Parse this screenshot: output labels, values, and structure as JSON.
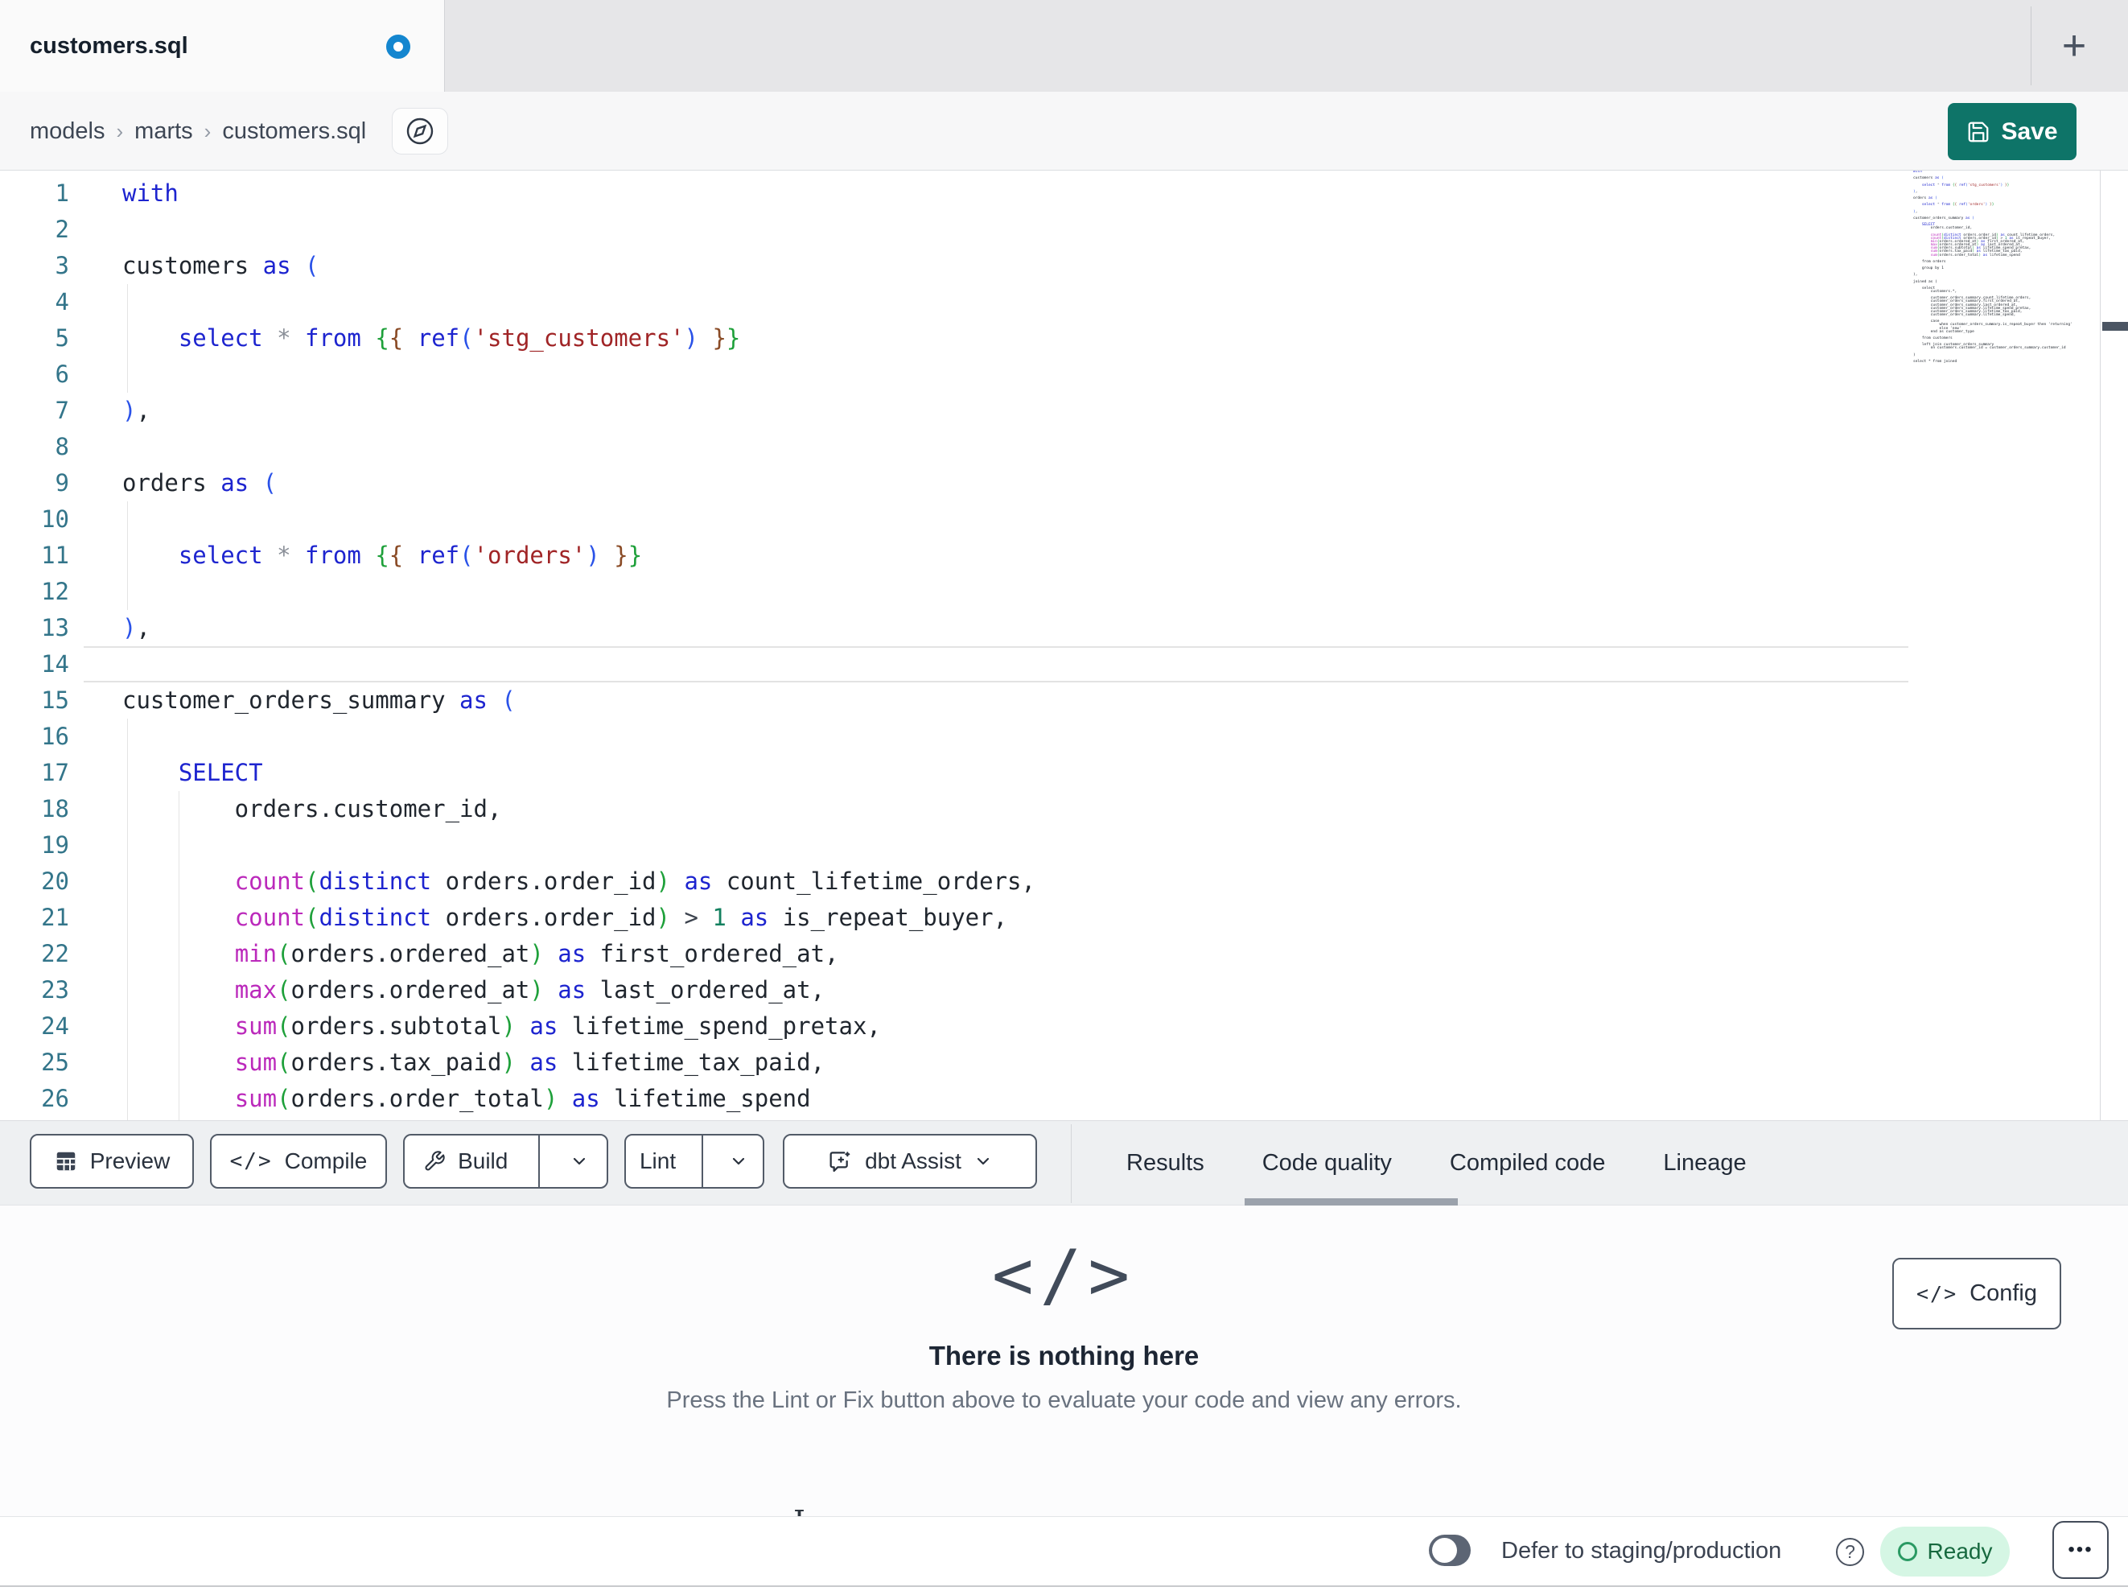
{
  "tab_bar": {
    "active_tab": "customers.sql",
    "new_tab_button": "+"
  },
  "breadcrumb": {
    "items": [
      "models",
      "marts",
      "customers.sql"
    ],
    "separator": "›"
  },
  "header": {
    "save_label": "Save"
  },
  "editor": {
    "active_line": 14,
    "line_count_visible": 26,
    "lines": [
      [
        [
          "with",
          "k"
        ]
      ],
      [],
      [
        [
          "customers ",
          "t"
        ],
        [
          "as",
          "k"
        ],
        [
          " ",
          "t"
        ],
        [
          "(",
          "p1"
        ]
      ],
      [],
      [
        [
          "    ",
          "t"
        ],
        [
          "select",
          "k"
        ],
        [
          " ",
          "t"
        ],
        [
          "*",
          "o"
        ],
        [
          " ",
          "t"
        ],
        [
          "from",
          "k"
        ],
        [
          " ",
          "t"
        ],
        [
          "{",
          "p2"
        ],
        [
          "{",
          "p3"
        ],
        [
          " ",
          "t"
        ],
        [
          "ref",
          "k"
        ],
        [
          "(",
          "p1"
        ],
        [
          "'stg_customers'",
          "s"
        ],
        [
          ")",
          "p1"
        ],
        [
          " ",
          "t"
        ],
        [
          "}",
          "p3"
        ],
        [
          "}",
          "p2"
        ]
      ],
      [],
      [
        [
          ")",
          "p1"
        ],
        [
          ",",
          "t"
        ]
      ],
      [],
      [
        [
          "orders ",
          "t"
        ],
        [
          "as",
          "k"
        ],
        [
          " ",
          "t"
        ],
        [
          "(",
          "p1"
        ]
      ],
      [],
      [
        [
          "    ",
          "t"
        ],
        [
          "select",
          "k"
        ],
        [
          " ",
          "t"
        ],
        [
          "*",
          "o"
        ],
        [
          " ",
          "t"
        ],
        [
          "from",
          "k"
        ],
        [
          " ",
          "t"
        ],
        [
          "{",
          "p2"
        ],
        [
          "{",
          "p3"
        ],
        [
          " ",
          "t"
        ],
        [
          "ref",
          "k"
        ],
        [
          "(",
          "p1"
        ],
        [
          "'orders'",
          "s"
        ],
        [
          ")",
          "p1"
        ],
        [
          " ",
          "t"
        ],
        [
          "}",
          "p3"
        ],
        [
          "}",
          "p2"
        ]
      ],
      [],
      [
        [
          ")",
          "p1"
        ],
        [
          ",",
          "t"
        ]
      ],
      [],
      [
        [
          "customer_orders_summary ",
          "t"
        ],
        [
          "as",
          "k"
        ],
        [
          " ",
          "t"
        ],
        [
          "(",
          "p1"
        ]
      ],
      [],
      [
        [
          "    ",
          "t"
        ],
        [
          "SELECT",
          "k"
        ]
      ],
      [
        [
          "        orders.customer_id,",
          "t"
        ]
      ],
      [],
      [
        [
          "        ",
          "t"
        ],
        [
          "count",
          "f"
        ],
        [
          "(",
          "p2"
        ],
        [
          "distinct",
          "k"
        ],
        [
          " orders.order_id",
          "t"
        ],
        [
          ")",
          "p2"
        ],
        [
          " ",
          "t"
        ],
        [
          "as",
          "k"
        ],
        [
          " count_lifetime_orders,",
          "t"
        ]
      ],
      [
        [
          "        ",
          "t"
        ],
        [
          "count",
          "f"
        ],
        [
          "(",
          "p2"
        ],
        [
          "distinct",
          "k"
        ],
        [
          " orders.order_id",
          "t"
        ],
        [
          ")",
          "p2"
        ],
        [
          " ",
          "t"
        ],
        [
          ">",
          "o2"
        ],
        [
          " ",
          "t"
        ],
        [
          "1",
          "n"
        ],
        [
          " ",
          "t"
        ],
        [
          "as",
          "k"
        ],
        [
          " is_repeat_buyer,",
          "t"
        ]
      ],
      [
        [
          "        ",
          "t"
        ],
        [
          "min",
          "f"
        ],
        [
          "(",
          "p2"
        ],
        [
          "orders.ordered_at",
          "t"
        ],
        [
          ")",
          "p2"
        ],
        [
          " ",
          "t"
        ],
        [
          "as",
          "k"
        ],
        [
          " first_ordered_at,",
          "t"
        ]
      ],
      [
        [
          "        ",
          "t"
        ],
        [
          "max",
          "f"
        ],
        [
          "(",
          "p2"
        ],
        [
          "orders.ordered_at",
          "t"
        ],
        [
          ")",
          "p2"
        ],
        [
          " ",
          "t"
        ],
        [
          "as",
          "k"
        ],
        [
          " last_ordered_at,",
          "t"
        ]
      ],
      [
        [
          "        ",
          "t"
        ],
        [
          "sum",
          "f"
        ],
        [
          "(",
          "p2"
        ],
        [
          "orders.subtotal",
          "t"
        ],
        [
          ")",
          "p2"
        ],
        [
          " ",
          "t"
        ],
        [
          "as",
          "k"
        ],
        [
          " lifetime_spend_pretax,",
          "t"
        ]
      ],
      [
        [
          "        ",
          "t"
        ],
        [
          "sum",
          "f"
        ],
        [
          "(",
          "p2"
        ],
        [
          "orders.tax_paid",
          "t"
        ],
        [
          ")",
          "p2"
        ],
        [
          " ",
          "t"
        ],
        [
          "as",
          "k"
        ],
        [
          " lifetime_tax_paid,",
          "t"
        ]
      ],
      [
        [
          "        ",
          "t"
        ],
        [
          "sum",
          "f"
        ],
        [
          "(",
          "p2"
        ],
        [
          "orders.order_total",
          "t"
        ],
        [
          ")",
          "p2"
        ],
        [
          " ",
          "t"
        ],
        [
          "as",
          "k"
        ],
        [
          " lifetime_spend",
          "t"
        ]
      ]
    ],
    "minimap_continuation": [
      "",
      "    from orders",
      "",
      "    group by 1",
      "",
      "),",
      "",
      "joined as (",
      "",
      "    select",
      "        customers.*,",
      "",
      "        customer_orders_summary.count_lifetime_orders,",
      "        customer_orders_summary.first_ordered_at,",
      "        customer_orders_summary.last_ordered_at,",
      "        customer_orders_summary.lifetime_spend_pretax,",
      "        customer_orders_summary.lifetime_tax_paid,",
      "        customer_orders_summary.lifetime_spend,",
      "",
      "        case",
      "            when customer_orders_summary.is_repeat_buyer then 'returning'",
      "            else 'new'",
      "        end as customer_type",
      "",
      "    from customers",
      "",
      "    left join customer_orders_summary",
      "        on customers.customer_id = customer_orders_summary.customer_id",
      "",
      ")",
      "",
      "select * from joined"
    ]
  },
  "toolbar": {
    "preview_label": "Preview",
    "compile_label": "Compile",
    "build_label": "Build",
    "lint_label": "Lint",
    "dbt_assist_label": "dbt Assist"
  },
  "panel_tabs": {
    "items": [
      "Results",
      "Code quality",
      "Compiled code",
      "Lineage"
    ],
    "active": "Code quality"
  },
  "results_panel": {
    "config_label": "Config",
    "config_icon": "</>",
    "empty_icon": "</>",
    "empty_title": "There is nothing here",
    "empty_subtitle": "Press the Lint or Fix button above to evaluate your code and view any errors."
  },
  "status_bar": {
    "defer_label": "Defer to staging/production",
    "help_glyph": "?",
    "ready_label": "Ready",
    "menu_dots": "•••"
  },
  "colors": {
    "accent_teal": "#0e7468",
    "modified_dot_blue": "#1486cf",
    "ready_badge_bg": "#d5f6e4",
    "ready_badge_text": "#17693f",
    "line_number_teal": "#33758a"
  }
}
